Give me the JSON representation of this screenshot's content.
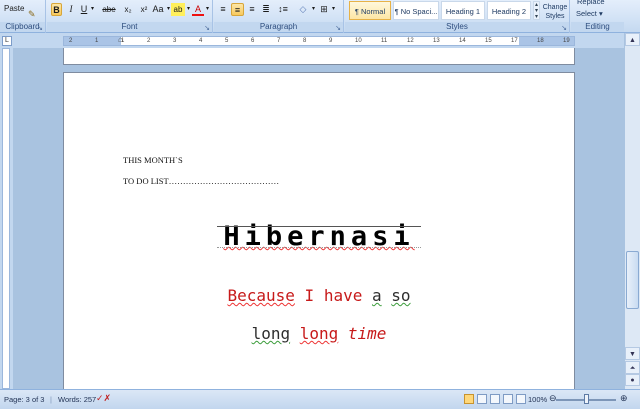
{
  "ribbon": {
    "clipboard": {
      "paste": "Paste",
      "label": "Clipboard"
    },
    "font": {
      "bold": "B",
      "italic": "I",
      "underline": "U",
      "strikethrough": "abe",
      "subscript": "x₂",
      "superscript": "x²",
      "change_case": "Aa",
      "highlight": "ab",
      "font_color": "A",
      "label": "Font"
    },
    "paragraph": {
      "label": "Paragraph"
    },
    "styles": {
      "items": [
        "¶ Normal",
        "¶ No Spaci...",
        "Heading 1",
        "Heading 2"
      ],
      "selected": "¶ Normal",
      "change_styles": "Change Styles",
      "label": "Styles"
    },
    "editing": {
      "replace": "Replace",
      "select": "Select",
      "label": "Editing"
    }
  },
  "ruler": {
    "ticks": [
      "2",
      "1",
      "1",
      "2",
      "3",
      "4",
      "5",
      "6",
      "7",
      "8",
      "9",
      "10",
      "11",
      "12",
      "13",
      "14",
      "15",
      "17",
      "18",
      "19"
    ]
  },
  "document": {
    "line1": "THIS MONTH`S",
    "line2": "TO DO LIST…………………………………",
    "title": "Hibernasi",
    "phrase1_a": "Because",
    "phrase1_b": "I have",
    "phrase1_c": "a",
    "phrase1_d": "so",
    "phrase2_a": "long",
    "phrase2_b": "long",
    "phrase2_c": "time"
  },
  "status": {
    "page": "Page: 3 of 3",
    "words": "Words: 257",
    "zoom": "100%"
  },
  "colors": {
    "ribbon": "#d3e3f6",
    "accent_red": "#c71a1a",
    "selected_style": "#fde6a6"
  }
}
